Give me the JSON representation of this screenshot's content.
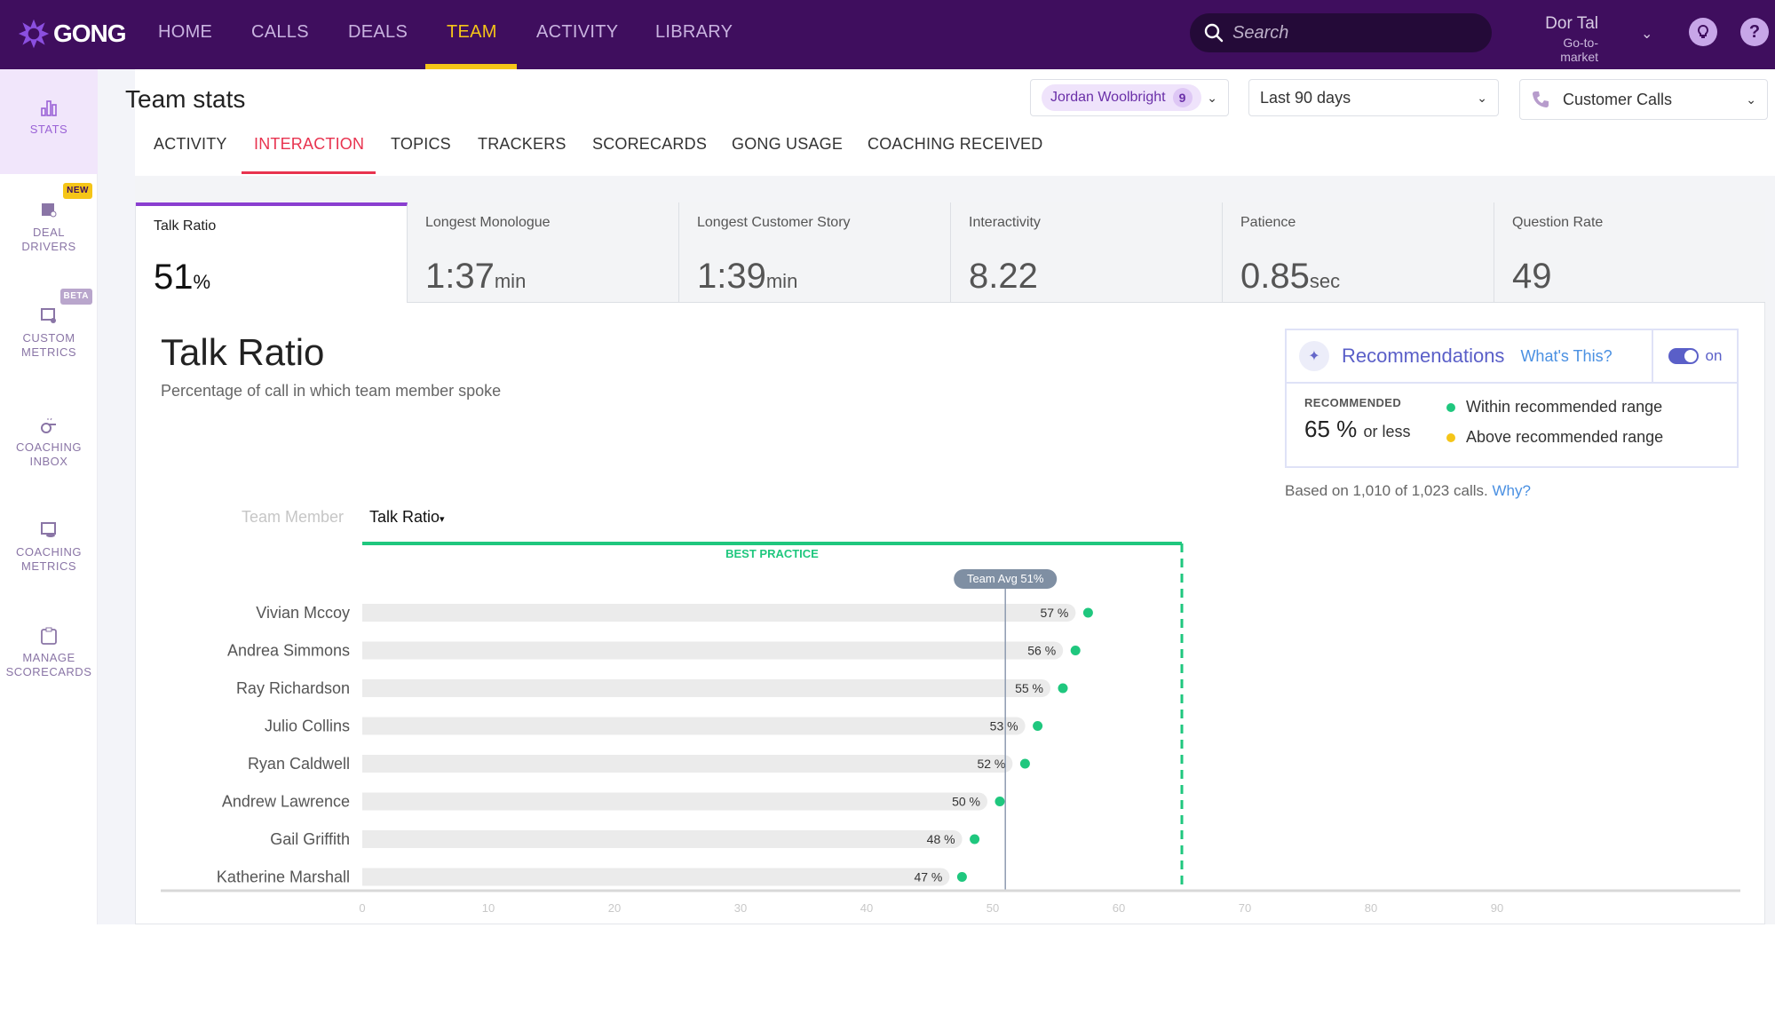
{
  "app": {
    "brand": "GONG"
  },
  "topnav": {
    "items": [
      {
        "label": "HOME",
        "active": false
      },
      {
        "label": "CALLS",
        "active": false
      },
      {
        "label": "DEALS",
        "active": false
      },
      {
        "label": "TEAM",
        "active": true
      },
      {
        "label": "ACTIVITY",
        "active": false
      },
      {
        "label": "LIBRARY",
        "active": false
      }
    ],
    "search_placeholder": "Search",
    "user": {
      "name": "Dor Tal",
      "role": "Go-to-market"
    },
    "icons": [
      "lightbulb-icon",
      "help-icon"
    ]
  },
  "sidebar": {
    "items": [
      {
        "label_lines": [
          "STATS"
        ],
        "icon": "bar-chart-icon",
        "active": true,
        "badge": null
      },
      {
        "label_lines": [
          "DEAL",
          "DRIVERS"
        ],
        "icon": "deal-drivers-icon",
        "active": false,
        "badge": "NEW"
      },
      {
        "label_lines": [
          "CUSTOM",
          "METRICS"
        ],
        "icon": "custom-metrics-icon",
        "active": false,
        "badge": "BETA"
      },
      {
        "label_lines": [
          "COACHING",
          "INBOX"
        ],
        "icon": "whistle-icon",
        "active": false,
        "badge": null
      },
      {
        "label_lines": [
          "COACHING",
          "METRICS"
        ],
        "icon": "coaching-metrics-icon",
        "active": false,
        "badge": null
      },
      {
        "label_lines": [
          "MANAGE",
          "SCORECARDS"
        ],
        "icon": "clipboard-icon",
        "active": false,
        "badge": null
      }
    ]
  },
  "header": {
    "title": "Team stats",
    "subtabs": [
      {
        "label": "ACTIVITY",
        "active": false
      },
      {
        "label": "INTERACTION",
        "active": true
      },
      {
        "label": "TOPICS",
        "active": false
      },
      {
        "label": "TRACKERS",
        "active": false
      },
      {
        "label": "SCORECARDS",
        "active": false
      },
      {
        "label": "GONG USAGE",
        "active": false
      },
      {
        "label": "COACHING RECEIVED",
        "active": false
      }
    ],
    "filters": {
      "team": {
        "name": "Jordan Woolbright",
        "count": "9"
      },
      "period": "Last 90 days",
      "call_type": "Customer Calls"
    }
  },
  "metrics": [
    {
      "label": "Talk Ratio",
      "value": "51",
      "unit": "%",
      "active": true
    },
    {
      "label": "Longest Monologue",
      "value": "1:37",
      "unit": "min",
      "active": false
    },
    {
      "label": "Longest Customer Story",
      "value": "1:39",
      "unit": "min",
      "active": false
    },
    {
      "label": "Interactivity",
      "value": "8.22",
      "unit": "",
      "active": false
    },
    {
      "label": "Patience",
      "value": "0.85",
      "unit": "sec",
      "active": false
    },
    {
      "label": "Question Rate",
      "value": "49",
      "unit": "",
      "active": false
    }
  ],
  "detail": {
    "title": "Talk Ratio",
    "subtitle": "Percentage of call in which team member spoke",
    "columns": {
      "member": "Team Member",
      "metric": "Talk Ratio"
    },
    "recommendations": {
      "title": "Recommendations",
      "whats_this": "What's This?",
      "toggle_label": "on",
      "toggle_on": true,
      "recommended_label": "RECOMMENDED",
      "recommended_value": "65 %",
      "recommended_suffix": "or less",
      "legend": [
        {
          "label": "Within recommended range",
          "color": "#1fc77e"
        },
        {
          "label": "Above recommended range",
          "color": "#f5c518"
        }
      ]
    },
    "based_on": "Based on 1,010 of 1,023 calls.",
    "why_link": "Why?"
  },
  "colors": {
    "nav_bg": "#3f0e5e",
    "accent_yellow": "#f5c518",
    "tab_active": "#e8334f",
    "metric_active_border": "#8a3ed0",
    "best_practice": "#1fc77e",
    "team_avg": "#7f8fa3"
  },
  "chart_data": {
    "type": "bar",
    "orientation": "horizontal",
    "title": "Talk Ratio",
    "xlabel": "",
    "ylabel": "Team Member",
    "categories": [
      "Vivian Mccoy",
      "Andrea Simmons",
      "Ray Richardson",
      "Julio Collins",
      "Ryan Caldwell",
      "Andrew Lawrence",
      "Gail Griffith",
      "Katherine Marshall"
    ],
    "values": [
      57,
      56,
      55,
      53,
      52,
      50,
      48,
      47
    ],
    "value_labels": [
      "57 %",
      "56 %",
      "55 %",
      "53 %",
      "52 %",
      "50 %",
      "48 %",
      "47 %"
    ],
    "point_status": [
      "within",
      "within",
      "within",
      "within",
      "within",
      "within",
      "within",
      "within"
    ],
    "xlim": [
      0,
      100
    ],
    "xticks": [
      0,
      10,
      20,
      30,
      40,
      50,
      60,
      70,
      80,
      90
    ],
    "reference_lines": {
      "team_avg": {
        "value": 51,
        "label": "Team Avg 51%"
      },
      "best_practice": {
        "max": 65,
        "label": "BEST PRACTICE"
      }
    },
    "grid": false
  }
}
